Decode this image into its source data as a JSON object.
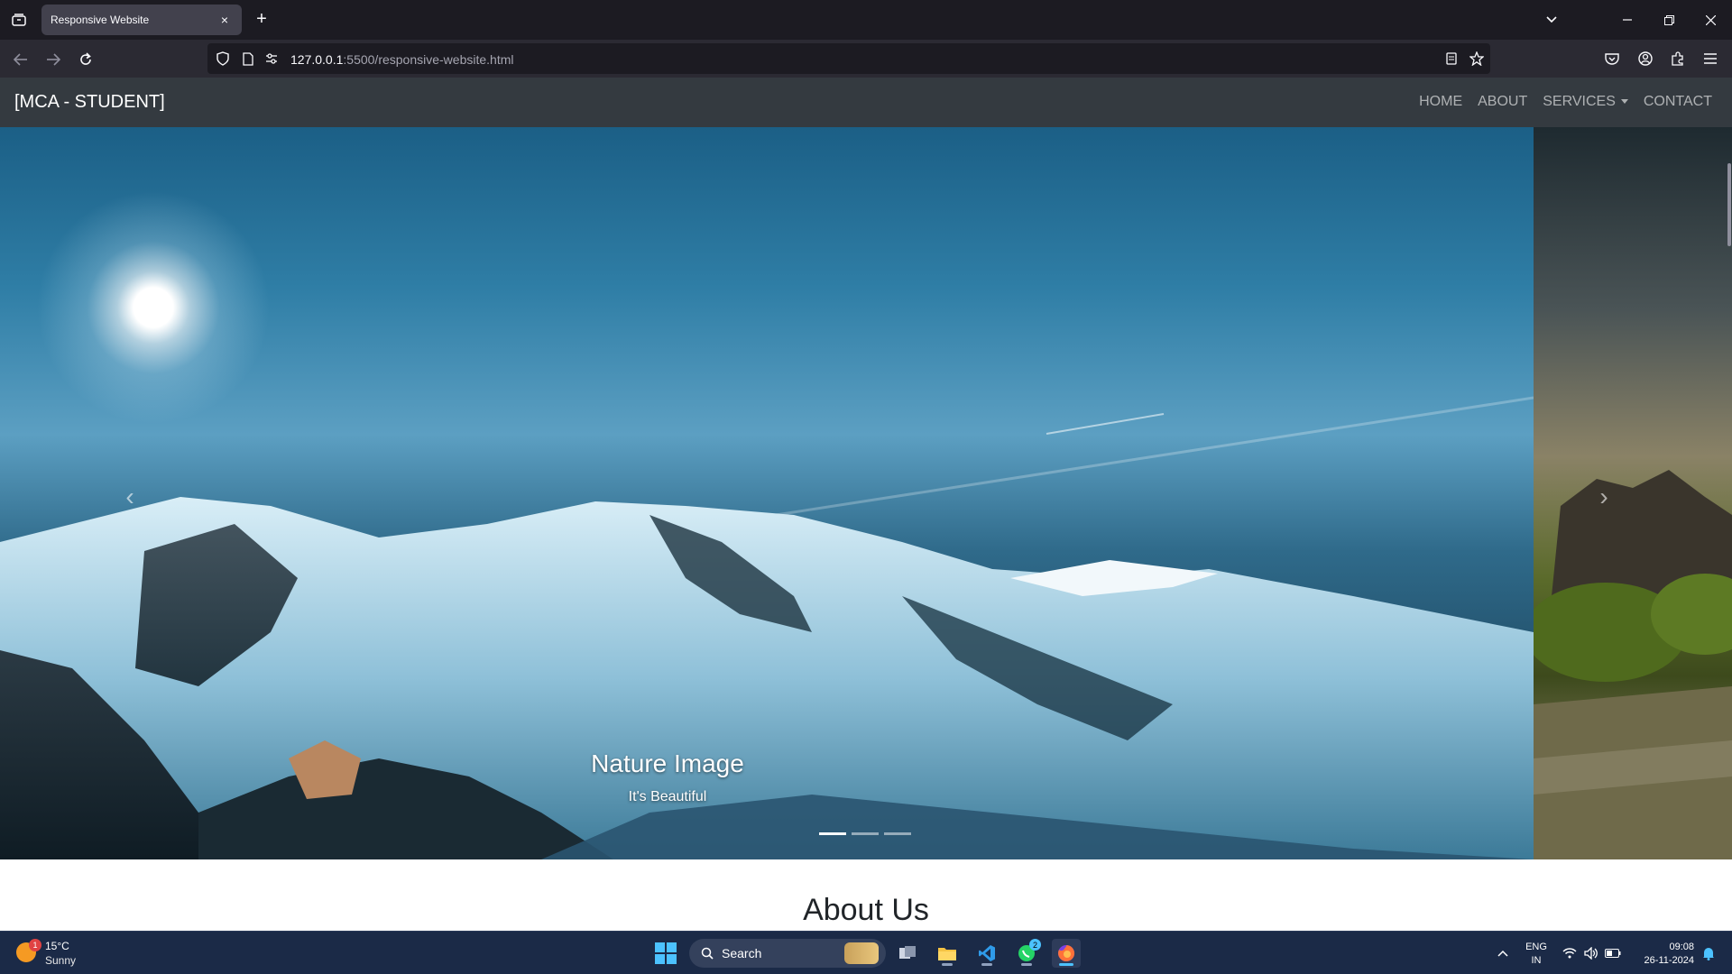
{
  "browser": {
    "tab": {
      "title": "Responsive Website",
      "close_icon": "×"
    },
    "new_tab_icon": "+",
    "url": {
      "host": "127.0.0.1",
      "path": ":5500/responsive-website.html"
    }
  },
  "site": {
    "brand": "[MCA - STUDENT]",
    "menu": {
      "home": "HOME",
      "about": "ABOUT",
      "services": "SERVICES",
      "contact": "CONTACT"
    },
    "carousel": {
      "caption_title": "Nature Image",
      "caption_text": "It's Beautiful",
      "slide_count": 3,
      "active_slide": 1,
      "prev_icon": "‹",
      "next_icon": "›"
    },
    "about_heading": "About Us"
  },
  "taskbar": {
    "weather": {
      "temp": "15°C",
      "condition": "Sunny",
      "badge": "1"
    },
    "search_placeholder": "Search",
    "whatsapp_badge": "2",
    "language": {
      "line1": "ENG",
      "line2": "IN"
    },
    "time": "09:08",
    "date": "26-11-2024"
  },
  "colors": {
    "navbar_bg": "#343a40",
    "browser_bg": "#1c1b22",
    "taskbar_bg": "#1b2a47",
    "accent": "#4cc2ff"
  }
}
